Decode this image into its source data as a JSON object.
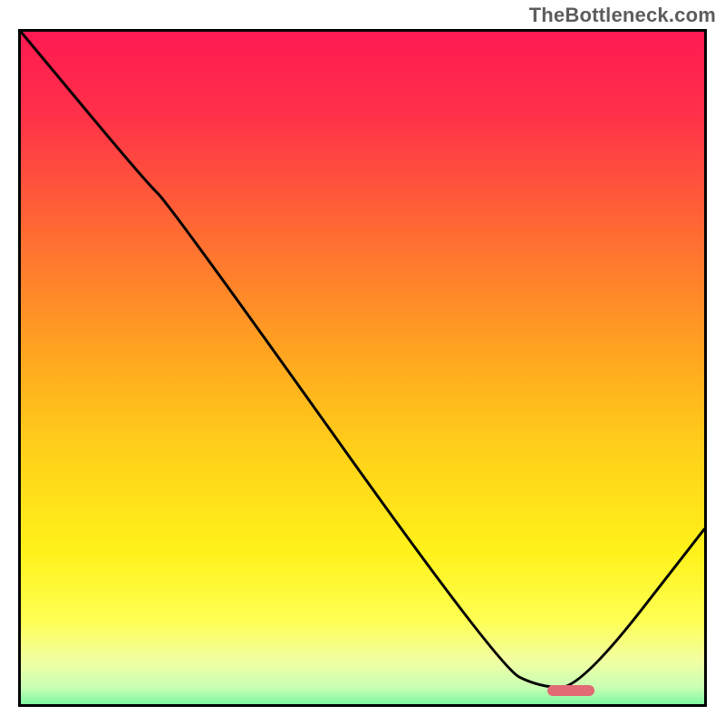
{
  "watermark": "TheBottleneck.com",
  "chart_data": {
    "type": "line",
    "title": "",
    "xlabel": "",
    "ylabel": "",
    "xlim": [
      0,
      100
    ],
    "ylim": [
      0,
      100
    ],
    "grid": false,
    "legend": false,
    "background_gradient": {
      "stops": [
        {
          "offset": 0.0,
          "color": "#ff1a52"
        },
        {
          "offset": 0.12,
          "color": "#ff3049"
        },
        {
          "offset": 0.3,
          "color": "#ff6d32"
        },
        {
          "offset": 0.48,
          "color": "#ffa81f"
        },
        {
          "offset": 0.62,
          "color": "#ffd219"
        },
        {
          "offset": 0.76,
          "color": "#fff21a"
        },
        {
          "offset": 0.86,
          "color": "#feff52"
        },
        {
          "offset": 0.92,
          "color": "#f2ffa2"
        },
        {
          "offset": 0.96,
          "color": "#c8ffb4"
        },
        {
          "offset": 0.985,
          "color": "#7cf7a0"
        },
        {
          "offset": 1.0,
          "color": "#2fe08b"
        }
      ]
    },
    "series": [
      {
        "name": "bottleneck-curve",
        "x": [
          0,
          18,
          22,
          70,
          76,
          82,
          100
        ],
        "values": [
          100,
          78,
          74,
          5.5,
          2.5,
          2.5,
          26
        ]
      }
    ],
    "marker": {
      "name": "optimal-range",
      "x_start": 77,
      "x_end": 84,
      "y": 2.0,
      "color": "#e16a75"
    }
  }
}
